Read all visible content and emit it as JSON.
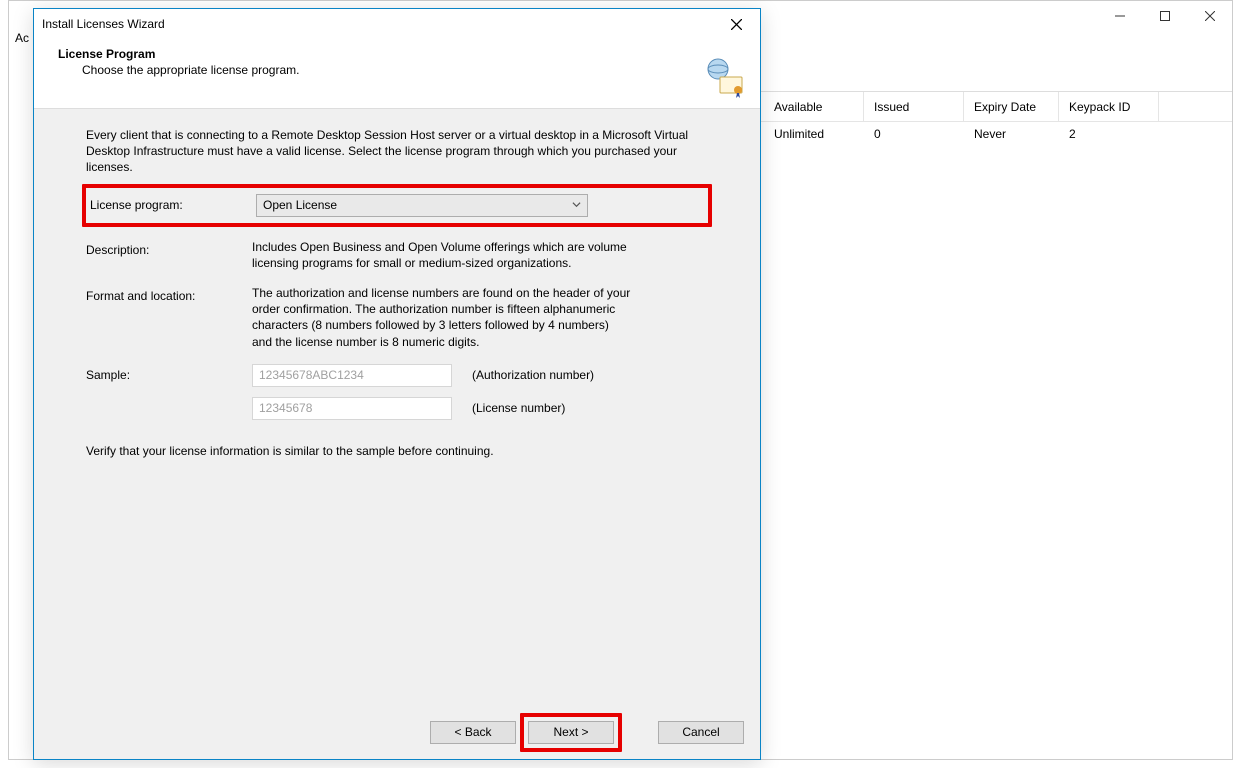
{
  "mainWindow": {
    "titleFragment": "Ac",
    "columns": {
      "available": "Available",
      "issued": "Issued",
      "expiry": "Expiry Date",
      "keypack": "Keypack ID"
    },
    "row": {
      "available": "Unlimited",
      "issued": "0",
      "expiry": "Never",
      "keypack": "2"
    }
  },
  "dialog": {
    "title": "Install Licenses Wizard",
    "headerTitle": "License Program",
    "headerSub": "Choose the appropriate license program.",
    "intro": "Every client that is connecting to a Remote Desktop Session Host server or a virtual desktop in a Microsoft Virtual Desktop Infrastructure must have a valid license. Select the license program through which you purchased your licenses.",
    "labels": {
      "licenseProgram": "License program:",
      "description": "Description:",
      "formatLocation": "Format and location:",
      "sample": "Sample:"
    },
    "combo": {
      "value": "Open License"
    },
    "descriptionText": "Includes Open Business and Open Volume offerings which are volume licensing programs for small or medium-sized organizations.",
    "formatText": "The authorization and license numbers are found on the header of your order confirmation. The authorization number is fifteen alphanumeric characters (8 numbers followed by 3 letters followed by 4 numbers) and the license number is 8 numeric digits.",
    "samples": {
      "authPlaceholder": "12345678ABC1234",
      "authDesc": "(Authorization number)",
      "licPlaceholder": "12345678",
      "licDesc": "(License number)"
    },
    "verifyText": "Verify that your license information is similar to the sample before continuing.",
    "buttons": {
      "back": "< Back",
      "next": "Next >",
      "cancel": "Cancel"
    }
  }
}
